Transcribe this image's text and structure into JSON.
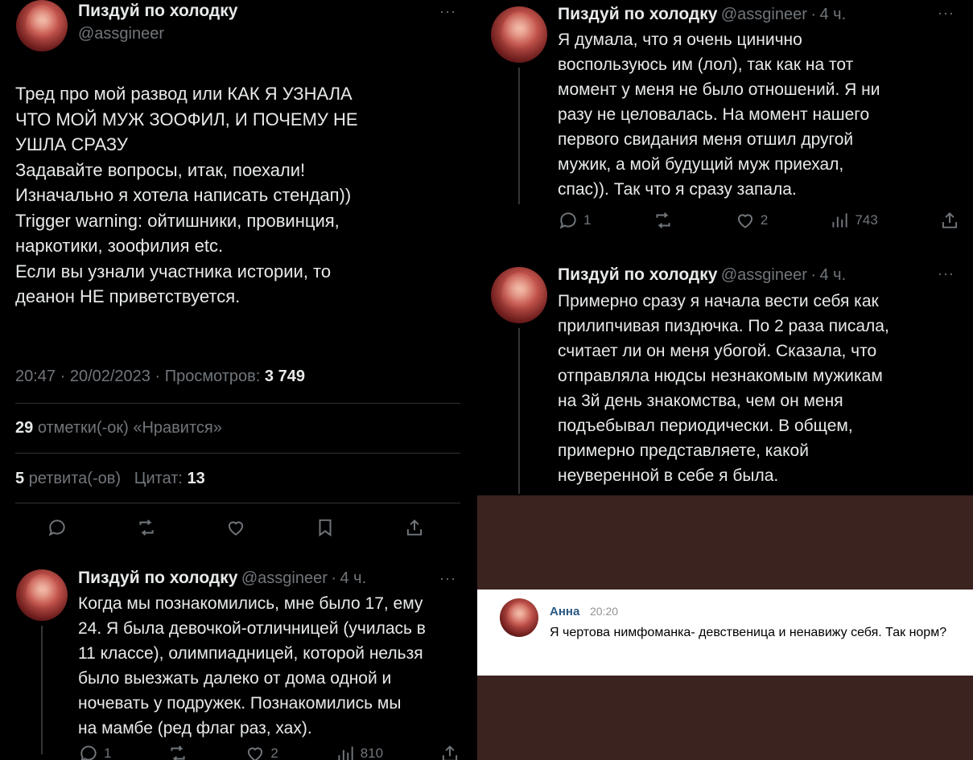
{
  "author": {
    "name": "Пиздуй по холодку",
    "handle": "@assgineer",
    "time_ago": "4 ч.",
    "more": "···"
  },
  "main_tweet": {
    "text": "Тред про мой развод или КАК Я УЗНАЛА\nЧТО МОЙ МУЖ ЗООФИЛ, И ПОЧЕМУ НЕ\nУШЛА СРАЗУ\nЗадавайте вопросы, итак, поехали!\nИзначально я хотела написать стендап))\nTrigger warning: ойтишники, провинция,\nнаркотики, зоофилия etc.\nЕсли вы узнали участника истории, то\nдеанон НЕ приветствуется.",
    "timestamp": "20:47 · 20/02/2023 · Просмотров:",
    "views": "3 749",
    "likes_count": "29",
    "likes_label": "отметки(-ок) «Нравится»",
    "retweets_count": "5",
    "retweets_label": "ретвита(-ов)",
    "quotes_label": "Цитат:",
    "quotes_count": "13"
  },
  "replies": [
    {
      "text": "Когда мы познакомились, мне было 17, ему\n24. Я была девочкой-отличницей (училась в\n11 классе), олимпиадницей, которой нельзя\nбыло выезжать далеко от дома одной и\nночевать у подружек. Познакомились мы\nна мамбе (ред флаг раз, хах).",
      "replies": "1",
      "likes": "2",
      "views": "810"
    },
    {
      "text": "Я думала, что я очень цинично\nвоспользуюсь им (лол), так как на тот\nмомент у меня не было отношений. Я ни\nразу не целовалась. На момент нашего\nпервого свидания меня отшил другой\nмужик, а мой будущий муж приехал,\nспас)). Так что я сразу запала.",
      "replies": "1",
      "likes": "2",
      "views": "743"
    },
    {
      "text": "Примерно сразу я начала вести себя как\nприлипчивая пиздючка. По 2 раза писала,\nсчитает ли он меня убогой. Сказала, что\nотправляла нюдсы незнакомым мужикам\nна 3й день знакомства, чем он меня\nподъебывал периодически. В общем,\nпримерно представляете, какой\nнеуверенной в себе я была."
    }
  ],
  "vk_comment": {
    "name": "Анна",
    "time": "20:20",
    "text": "Я чертова нимфоманка- девственица и ненавижу себя. Так норм?"
  },
  "colors": {
    "bg": "#000000",
    "text": "#e7e9ea",
    "muted": "#71767b",
    "vk_link": "#2a5885",
    "vk_backdrop": "#3b2320"
  }
}
